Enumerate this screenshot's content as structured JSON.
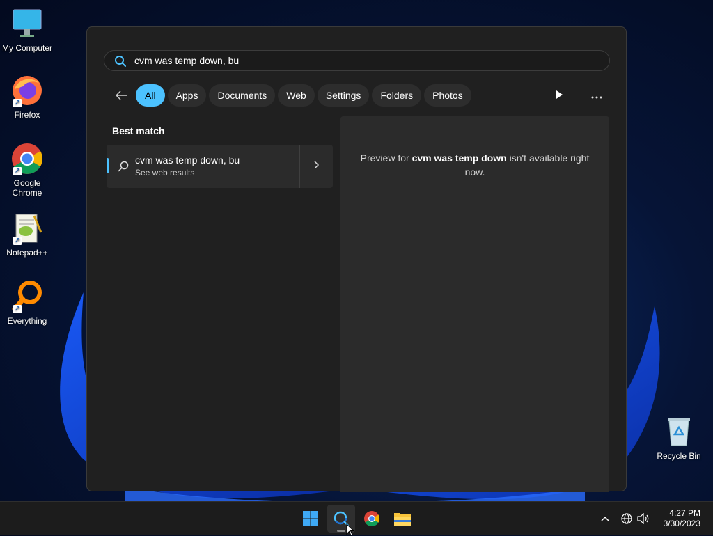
{
  "desktop": {
    "icons": [
      {
        "label": "My Computer",
        "icon": "monitor-icon"
      },
      {
        "label": "Firefox",
        "icon": "firefox-icon"
      },
      {
        "label": "Google Chrome",
        "icon": "chrome-icon"
      },
      {
        "label": "Notepad++",
        "icon": "notepadpp-icon"
      },
      {
        "label": "Everything",
        "icon": "everything-icon"
      },
      {
        "label": "Recycle Bin",
        "icon": "recycle-bin-icon"
      }
    ]
  },
  "search": {
    "query": "cvm was temp down, bu",
    "filters": [
      "All",
      "Apps",
      "Documents",
      "Web",
      "Settings",
      "Folders",
      "Photos"
    ],
    "active_filter": "All",
    "best_match_label": "Best match",
    "result": {
      "title": "cvm was temp down, bu",
      "subtitle": "See web results"
    },
    "preview": {
      "prefix": "Preview for ",
      "term": "cvm was temp down",
      "suffix": " isn't available right now."
    }
  },
  "taskbar": {
    "apps": [
      "start-icon",
      "search-icon",
      "chrome-icon",
      "file-explorer-icon"
    ],
    "tray_icons": [
      "chevron-up-icon",
      "network-icon",
      "volume-icon"
    ],
    "time": "4:27 PM",
    "date": "3/30/2023"
  },
  "colors": {
    "accent": "#4cc2ff",
    "panel": "#202020",
    "taskbar": "#1c1c1c"
  }
}
